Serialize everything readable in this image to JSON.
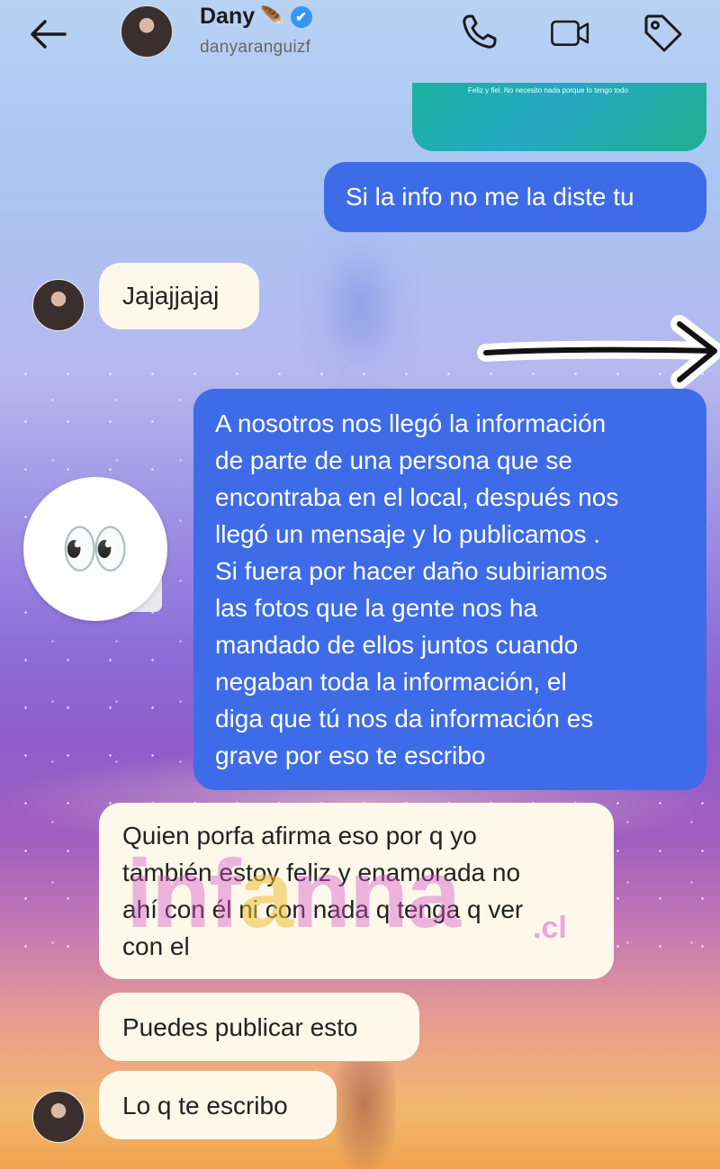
{
  "header": {
    "name": "Dany",
    "name_emoji": "🪶",
    "verified_mark": "✔",
    "username": "danyaranguizf",
    "icons": [
      "back-arrow-icon",
      "phone-icon",
      "video-icon",
      "tag-icon"
    ]
  },
  "previous_message": {
    "text": "Feliz y fiel. No necesito nada porque lo tengo todo"
  },
  "messages": [
    {
      "from": "me",
      "text": "Si la info no me la diste tu"
    },
    {
      "from": "them",
      "text": "Jajajjajaj"
    },
    {
      "from": "me",
      "lines": [
        "A nosotros nos llegó la información",
        "de parte de una persona que se",
        "encontraba en el local, después nos",
        "llegó un mensaje y lo publicamos .",
        "Si fuera por hacer daño subiriamos",
        "las fotos que la gente nos ha",
        "mandado de ellos juntos cuando",
        "negaban toda la información, el",
        "diga que tú nos da información es",
        "grave por eso te escribo"
      ]
    },
    {
      "from": "them",
      "lines": [
        "Quien porfa afirma eso por q yo",
        "también estoy feliz y enamorada no",
        "ahí con él ni con nada q tenga q ver",
        "con el"
      ]
    },
    {
      "from": "them",
      "text": "Puedes publicar esto"
    },
    {
      "from": "them",
      "text": "Lo q te escribo"
    }
  ],
  "reaction": {
    "emoji": "👀"
  },
  "watermark": {
    "main_a": "inf",
    "main_b": "a",
    "main_c": "nna",
    "suffix": ".cl"
  },
  "colors": {
    "sent_bubble": "#3e6ce8",
    "received_bubble": "#fdf8ea",
    "verified": "#3797f0"
  }
}
